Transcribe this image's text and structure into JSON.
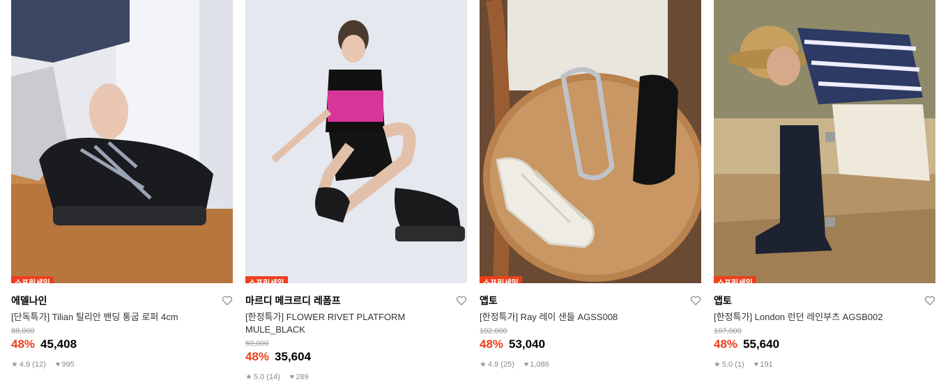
{
  "colors": {
    "accent": "#ef3e1b"
  },
  "products": [
    {
      "badge": "스프링세일",
      "brand": "에델나인",
      "title": "[단독특가] Tilian 틸리안 밴딩 통굽 로퍼 4cm",
      "original_price": "88,000",
      "discount": "48%",
      "price": "45,408",
      "rating": "4.9 (12)",
      "likes": "995",
      "image": "black-platform-loafer-photo"
    },
    {
      "badge": "스프링세일",
      "brand": "마르디 메크르디 레폼프",
      "title": "[한정특가] FLOWER RIVET PLATFORM MULE_BLACK",
      "original_price": "69,000",
      "discount": "48%",
      "price": "35,604",
      "rating": "5.0 (14)",
      "likes": "289",
      "image": "model-black-mule-photo"
    },
    {
      "badge": "스프링세일",
      "brand": "앱토",
      "title": "[한정특가] Ray 레이 샌들 AGSS008",
      "original_price": "102,000",
      "discount": "48%",
      "price": "53,040",
      "rating": "4.9 (25)",
      "likes": "1,086",
      "image": "strappy-sandals-chair-photo"
    },
    {
      "badge": "스프링세일",
      "brand": "앱토",
      "title": "[한정특가] London 런던 레인부츠 AGSB002",
      "original_price": "107,000",
      "discount": "48%",
      "price": "55,640",
      "rating": "5.0 (1)",
      "likes": "191",
      "image": "model-rain-boots-photo"
    }
  ]
}
